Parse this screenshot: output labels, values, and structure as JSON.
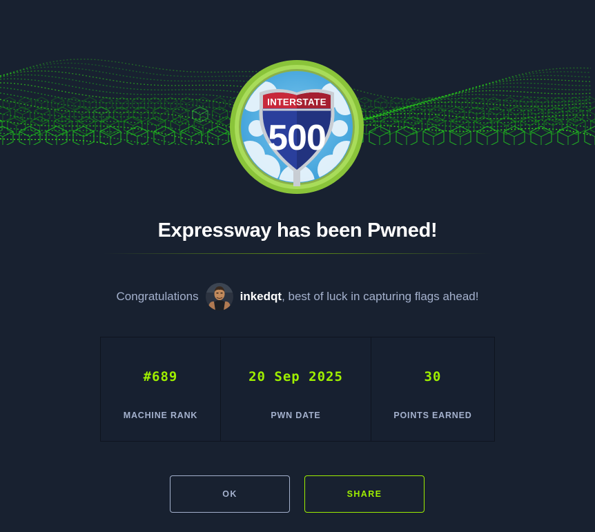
{
  "colors": {
    "background": "#182130",
    "accent": "#9fef00",
    "muted_text": "#a4b1cd",
    "heading": "#ffffff"
  },
  "badge": {
    "sign_top_text": "INTERSTATE",
    "sign_number": "500"
  },
  "modal": {
    "title": "Expressway has been Pwned!",
    "congrats_prefix": "Congratulations",
    "username": "inkedqt",
    "congrats_suffix": ", best of luck in capturing flags ahead!"
  },
  "stats": [
    {
      "value": "#689",
      "label": "MACHINE RANK"
    },
    {
      "value": "20 Sep 2025",
      "label": "PWN DATE"
    },
    {
      "value": "30",
      "label": "POINTS EARNED"
    }
  ],
  "buttons": {
    "ok_label": "OK",
    "share_label": "SHARE"
  },
  "icons": {
    "banner": "green-cyber-grid-banner",
    "badge": "interstate-shield-badge",
    "avatar": "user-avatar"
  }
}
